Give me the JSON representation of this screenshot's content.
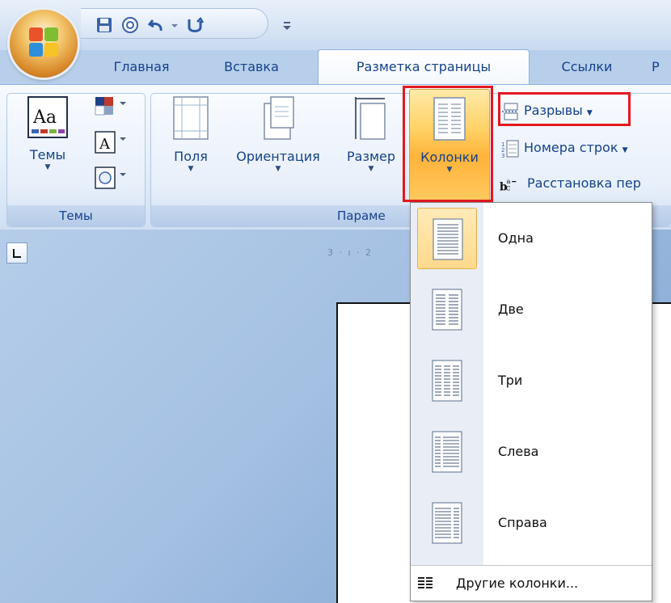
{
  "tabs": {
    "home": "Главная",
    "insert": "Вставка",
    "page_layout": "Разметка страницы",
    "references": "Ссылки",
    "review": "Р"
  },
  "ribbon": {
    "themes_group": {
      "label": "Темы",
      "themes_button": "Темы"
    },
    "page_setup_group": {
      "label": "Параме",
      "margins": "Поля",
      "orientation": "Ориентация",
      "size": "Размер",
      "columns": "Колонки",
      "breaks": "Разрывы",
      "line_numbers": "Номера строк",
      "hyphenation": "Расстановка пер"
    }
  },
  "ruler": {
    "marks": "3 · ı · 2"
  },
  "columns_menu": {
    "items": [
      {
        "label": "Одна",
        "icon": "one-column-icon",
        "selected": true
      },
      {
        "label": "Две",
        "icon": "two-columns-icon",
        "selected": false
      },
      {
        "label": "Три",
        "icon": "three-columns-icon",
        "selected": false
      },
      {
        "label": "Слева",
        "icon": "left-column-icon",
        "selected": false
      },
      {
        "label": "Справа",
        "icon": "right-column-icon",
        "selected": false
      }
    ],
    "more_columns": "Другие колонки..."
  },
  "colors": {
    "accent_blue": "#15428b",
    "highlight_red": "#e31820",
    "selected_orange": "#ffb33a"
  }
}
